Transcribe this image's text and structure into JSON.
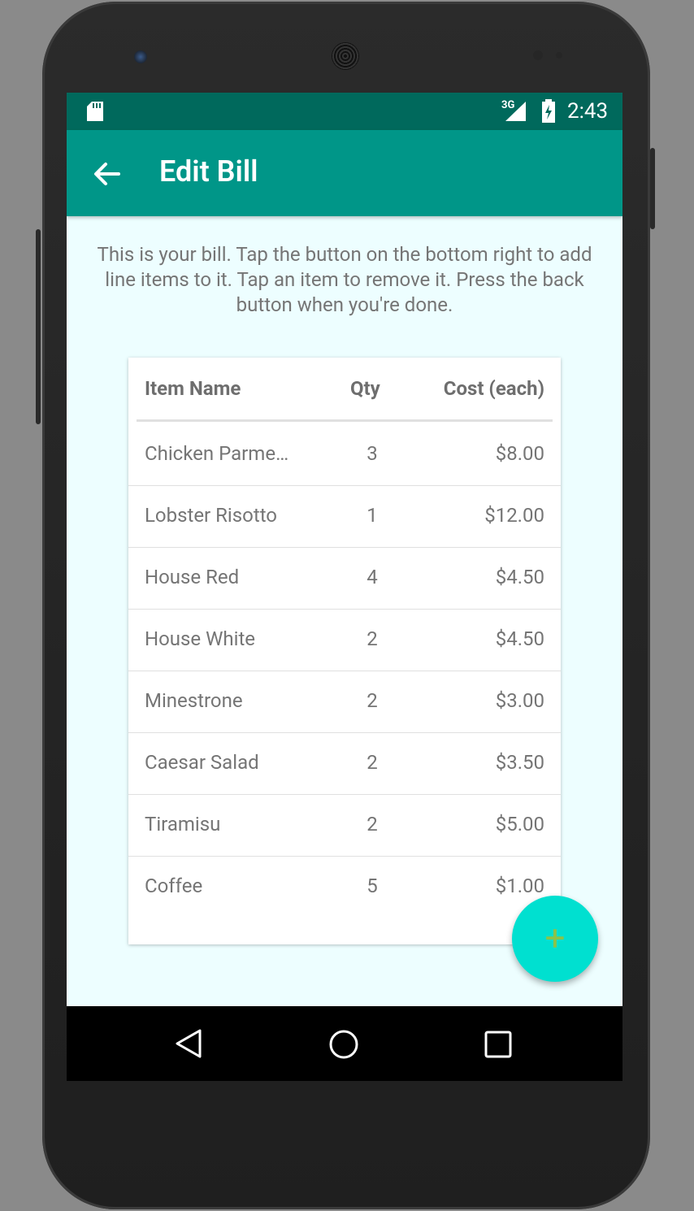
{
  "status_bar": {
    "network": "3G",
    "time": "2:43"
  },
  "app_bar": {
    "title": "Edit Bill"
  },
  "instructions": "This is your bill. Tap the button on the bottom right to add line items to it. Tap an item to remove it. Press the back button when you're done.",
  "table": {
    "headers": {
      "name": "Item Name",
      "qty": "Qty",
      "cost": "Cost (each)"
    },
    "rows": [
      {
        "name": "Chicken Parme…",
        "qty": "3",
        "cost": "$8.00"
      },
      {
        "name": "Lobster Risotto",
        "qty": "1",
        "cost": "$12.00"
      },
      {
        "name": "House Red",
        "qty": "4",
        "cost": "$4.50"
      },
      {
        "name": "House White",
        "qty": "2",
        "cost": "$4.50"
      },
      {
        "name": "Minestrone",
        "qty": "2",
        "cost": "$3.00"
      },
      {
        "name": "Caesar Salad",
        "qty": "2",
        "cost": "$3.50"
      },
      {
        "name": "Tiramisu",
        "qty": "2",
        "cost": "$5.00"
      },
      {
        "name": "Coffee",
        "qty": "5",
        "cost": "$1.00"
      }
    ]
  },
  "fab": {
    "label": "+",
    "icon": "add-icon"
  },
  "colors": {
    "status_bar": "#00695c",
    "app_bar": "#009688",
    "background": "#edfeff",
    "fab": "#00e0d0",
    "fab_icon": "#8bc34a"
  },
  "nav_bar": {
    "icons": [
      "back-nav-icon",
      "home-nav-icon",
      "recents-nav-icon"
    ]
  }
}
